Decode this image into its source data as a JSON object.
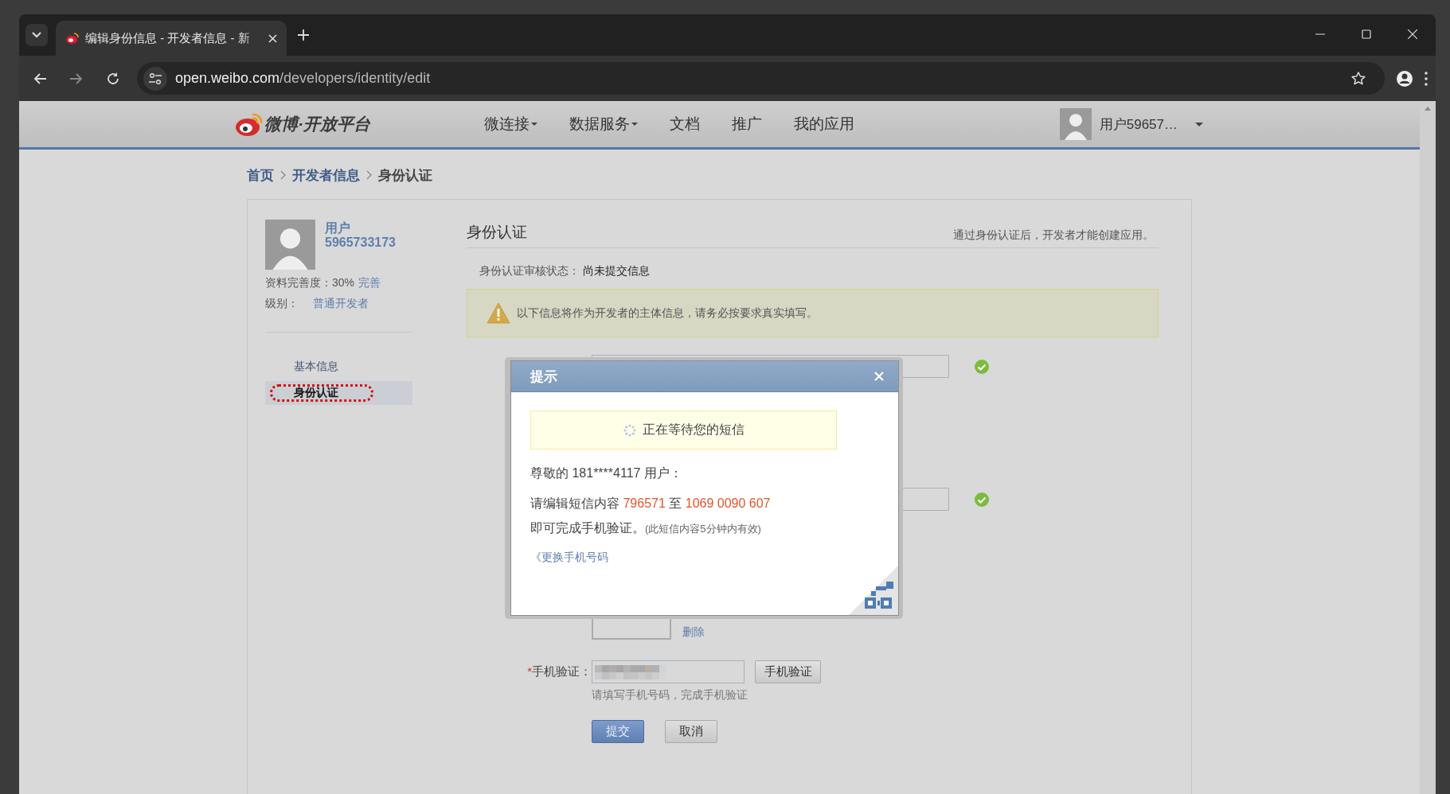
{
  "browser": {
    "tab_title": "编辑身份信息 - 开发者信息 - 新",
    "url_domain": "open.weibo.com",
    "url_path": "/developers/identity/edit"
  },
  "header": {
    "logo_text": "微博·开放平台",
    "nav": [
      {
        "label": "微连接",
        "dropdown": true
      },
      {
        "label": "数据服务",
        "dropdown": true
      },
      {
        "label": "文档",
        "dropdown": false
      },
      {
        "label": "推广",
        "dropdown": false
      },
      {
        "label": "我的应用",
        "dropdown": false
      }
    ],
    "user_name": "用户59657…"
  },
  "breadcrumb": [
    {
      "label": "首页",
      "link": true
    },
    {
      "label": "开发者信息",
      "link": true
    },
    {
      "label": "身份认证",
      "link": false
    }
  ],
  "profile": {
    "name": "用户5965733173",
    "completeness_label": "资料完善度：",
    "completeness": "30%",
    "complete_link": "完善",
    "level_label": "级别：",
    "level": "普通开发者"
  },
  "side_nav": [
    {
      "label": "基本信息",
      "selected": false
    },
    {
      "label": "身份认证",
      "selected": true
    }
  ],
  "section": {
    "title": "身份认证",
    "note": "通过身份认证后，开发者才能创建应用。",
    "status_label": "身份认证审核状态：",
    "status": "尚未提交信息",
    "warning": "以下信息将作为开发者的主体信息，请务必按要求真实填写。"
  },
  "form": {
    "fields": [
      {
        "kind": "input",
        "valid": true
      },
      {
        "kind": "input",
        "valid": true
      },
      {
        "kind": "image",
        "action": "删除"
      },
      {
        "kind": "phone",
        "label": "手机验证：",
        "required_mark": "*",
        "button": "手机验证",
        "hint": "请填写手机号码，完成手机验证"
      }
    ],
    "buttons": [
      {
        "label": "提交",
        "kind": "primary"
      },
      {
        "label": "取消",
        "kind": "secondary"
      }
    ]
  },
  "dialog": {
    "title": "提示",
    "waiting": "正在等待您的短信",
    "greeting": "尊敬的 181****4117 用户：",
    "instruction": [
      {
        "text": "请编辑短信内容 ",
        "highlight": false
      },
      {
        "text": "796571",
        "highlight": true
      },
      {
        "text": " 至 ",
        "highlight": false
      },
      {
        "text": "1069 0090 607",
        "highlight": true
      }
    ],
    "complete": "即可完成手机验证。",
    "validity": "(此短信内容5分钟内有效)",
    "change_link": "《更换手机号码"
  }
}
